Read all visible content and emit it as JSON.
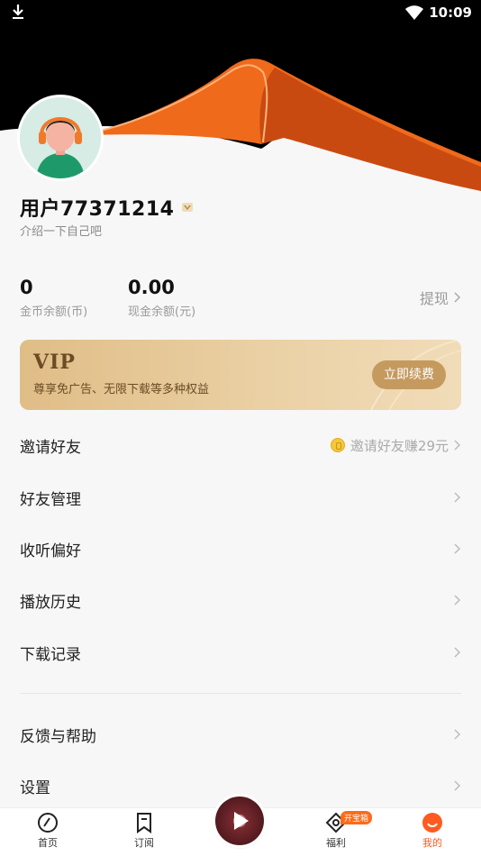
{
  "status_bar": {
    "time": "10:09"
  },
  "profile": {
    "username": "用户77371214",
    "bio": "介绍一下自己吧"
  },
  "stats": {
    "coins_value": "0",
    "coins_label": "金币余额(币)",
    "cash_value": "0.00",
    "cash_label": "现金余额(元)",
    "withdraw_label": "提现"
  },
  "vip": {
    "title": "VIP",
    "description": "尊享免广告、无限下载等多种权益",
    "button_label": "立即续费"
  },
  "menu": {
    "invite_label": "邀请好友",
    "invite_hint": "邀请好友赚29元",
    "friends_label": "好友管理",
    "preferences_label": "收听偏好",
    "history_label": "播放历史",
    "downloads_label": "下载记录",
    "feedback_label": "反馈与帮助",
    "settings_label": "设置"
  },
  "tabbar": {
    "home_label": "首页",
    "subscribe_label": "订阅",
    "welfare_label": "福利",
    "welfare_badge": "开宝箱",
    "mine_label": "我的"
  },
  "colors": {
    "accent": "#ff5a1f",
    "vip_gold": "#e0bd87",
    "hero_dark": "#000000"
  }
}
